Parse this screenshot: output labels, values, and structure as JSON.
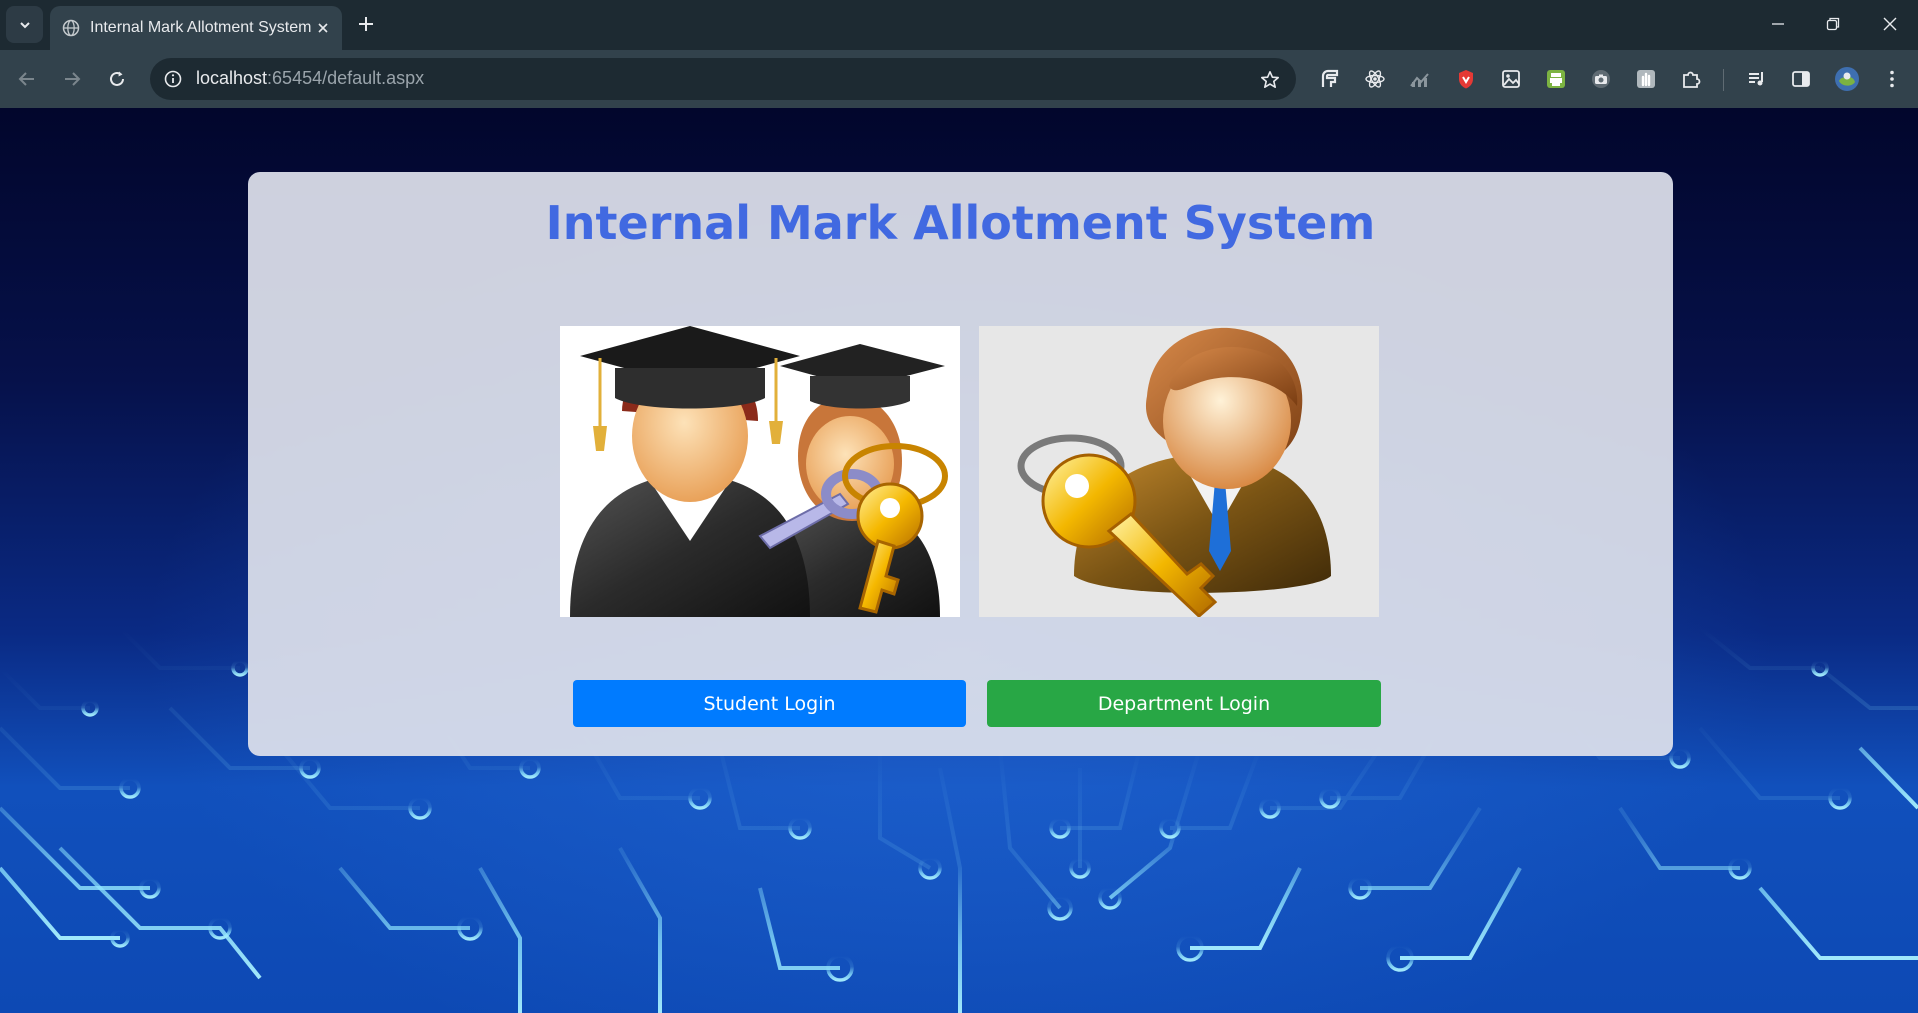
{
  "browser": {
    "tab_title": "Internal Mark Allotment System",
    "url_host": "localhost",
    "url_rest": ":65454/default.aspx",
    "icons": {
      "tab_list": "chevron-down-icon",
      "favicon": "globe-icon",
      "close_tab": "close-icon",
      "new_tab": "plus-icon",
      "back": "arrow-left-icon",
      "forward": "arrow-right-icon",
      "reload": "reload-icon",
      "site_info": "info-icon",
      "bookmark": "star-icon",
      "minimize": "minimize-icon",
      "restore": "restore-icon",
      "close_window": "close-window-icon",
      "extensions": [
        "extension-f-icon",
        "react-icon",
        "chart-icon",
        "shield-icon",
        "image-icon",
        "printer-icon",
        "camera-icon",
        "hand-icon",
        "puzzle-icon"
      ],
      "media": "media-icon",
      "side_panel": "side-panel-icon",
      "profile": "avatar",
      "menu": "more-vertical-icon"
    }
  },
  "page": {
    "title": "Internal Mark Allotment System",
    "student_image": "graduates-with-key-image",
    "department_image": "businessman-with-key-image",
    "student_login": "Student Login",
    "department_login": "Department Login"
  },
  "colors": {
    "title": "#4169e1",
    "student_button": "#007bff",
    "department_button": "#28a745"
  }
}
